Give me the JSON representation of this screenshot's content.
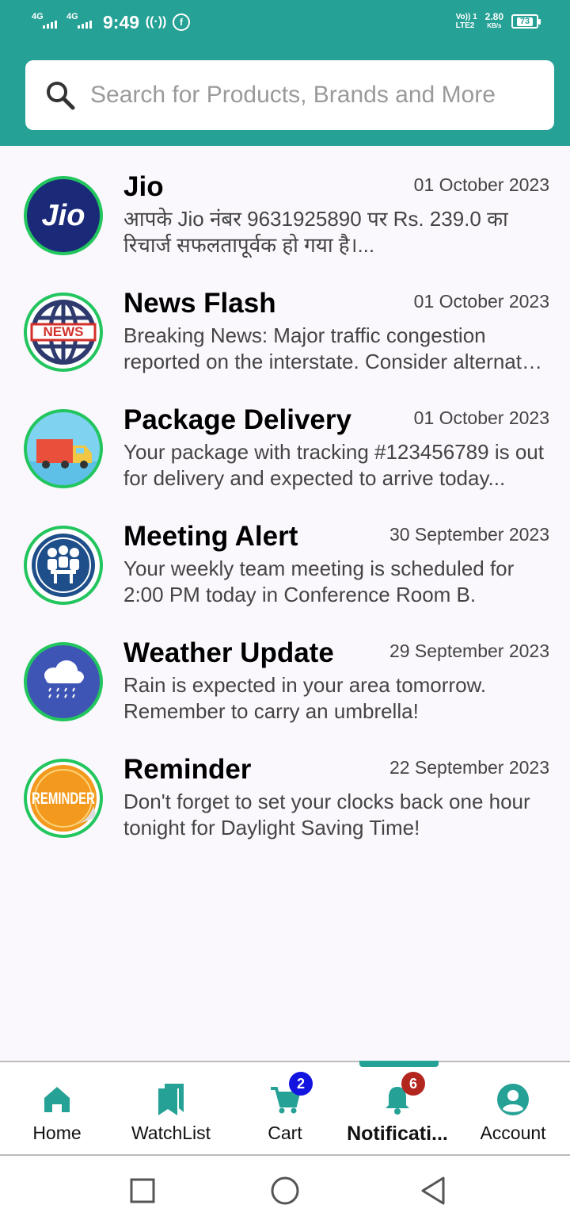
{
  "status_bar": {
    "network_1": "4G",
    "network_2": "4G",
    "time": "9:49",
    "volte_1": "Vo)) 1",
    "volte_2": "LTE2",
    "speed_value": "2.80",
    "speed_unit": "KB/s",
    "battery": "73"
  },
  "search": {
    "placeholder": "Search for Products, Brands and More"
  },
  "notifications": [
    {
      "title": "Jio",
      "date": "01 October 2023",
      "message": "आपके Jio नंबर 9631925890 पर Rs. 239.0 का रिचार्ज सफलतापूर्वक हो गया है।...",
      "icon": "jio-logo",
      "icon_text": "Jio"
    },
    {
      "title": "News Flash",
      "date": "01 October 2023",
      "message": "Breaking News: Major traffic congestion reported on the interstate. Consider alternate routes...",
      "icon": "news-globe-icon",
      "icon_text": "NEWS"
    },
    {
      "title": "Package Delivery",
      "date": "01 October 2023",
      "message": "Your package with tracking #123456789 is out for delivery and expected to arrive today...",
      "icon": "delivery-truck-icon"
    },
    {
      "title": "Meeting Alert",
      "date": "30 September 2023",
      "message": "Your weekly team meeting is scheduled for 2:00 PM today in Conference Room B.",
      "icon": "meeting-people-icon"
    },
    {
      "title": "Weather Update",
      "date": "29 September 2023",
      "message": "Rain is expected in your area tomorrow. Remember to carry an umbrella!",
      "icon": "rain-cloud-icon"
    },
    {
      "title": "Reminder",
      "date": "22 September 2023",
      "message": "Don't forget to set your clocks back one hour tonight for Daylight Saving Time!",
      "icon": "reminder-sticker-icon",
      "icon_text": "REMINDER"
    }
  ],
  "bottom_nav": {
    "home": "Home",
    "watchlist": "WatchList",
    "cart": "Cart",
    "cart_badge": "2",
    "notifications": "Notificati...",
    "notifications_badge": "6",
    "account": "Account",
    "active": "notifications"
  },
  "colors": {
    "primary": "#26a196",
    "avatar_ring": "#22c55e",
    "cart_badge": "#1414e0",
    "notif_badge": "#b3261e"
  }
}
